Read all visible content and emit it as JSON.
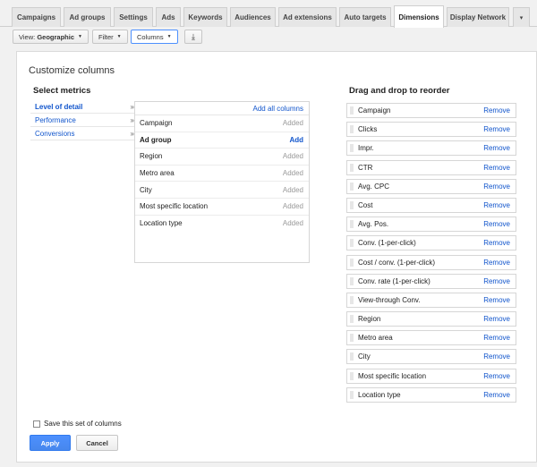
{
  "tabs": [
    {
      "label": "Campaigns"
    },
    {
      "label": "Ad groups"
    },
    {
      "label": "Settings"
    },
    {
      "label": "Ads"
    },
    {
      "label": "Keywords"
    },
    {
      "label": "Audiences"
    },
    {
      "label": "Ad extensions"
    },
    {
      "label": "Auto targets"
    },
    {
      "label": "Dimensions",
      "active": true
    },
    {
      "label": "Display Network"
    },
    {
      "label": "▾"
    }
  ],
  "toolbar": {
    "view_prefix": "View: ",
    "view_value": "Geographic",
    "filter_label": "Filter",
    "columns_label": "Columns",
    "download_icon": "download-icon"
  },
  "panel": {
    "title": "Customize columns",
    "select_heading": "Select metrics",
    "reorder_heading": "Drag and drop to reorder"
  },
  "categories": [
    {
      "label": "Level of detail",
      "arrow": "»"
    },
    {
      "label": "Performance",
      "arrow": "»"
    },
    {
      "label": "Conversions",
      "arrow": "»"
    }
  ],
  "metrics": {
    "add_all": "Add all columns",
    "rows": [
      {
        "label": "Campaign",
        "status": "Added"
      },
      {
        "label": "Ad group",
        "status": "Add"
      },
      {
        "label": "Region",
        "status": "Added"
      },
      {
        "label": "Metro area",
        "status": "Added"
      },
      {
        "label": "City",
        "status": "Added"
      },
      {
        "label": "Most specific location",
        "status": "Added"
      },
      {
        "label": "Location type",
        "status": "Added"
      }
    ]
  },
  "reorder": {
    "remove_label": "Remove",
    "items": [
      "Campaign",
      "Clicks",
      "Impr.",
      "CTR",
      "Avg. CPC",
      "Cost",
      "Avg. Pos.",
      "Conv. (1-per-click)",
      "Cost / conv. (1-per-click)",
      "Conv. rate (1-per-click)",
      "View-through Conv.",
      "Region",
      "Metro area",
      "City",
      "Most specific location",
      "Location type"
    ]
  },
  "footer": {
    "save_label": "Save this set of columns",
    "apply": "Apply",
    "cancel": "Cancel"
  },
  "colors": {
    "link": "#1155cc",
    "apply_bg": "#4d90fe"
  }
}
